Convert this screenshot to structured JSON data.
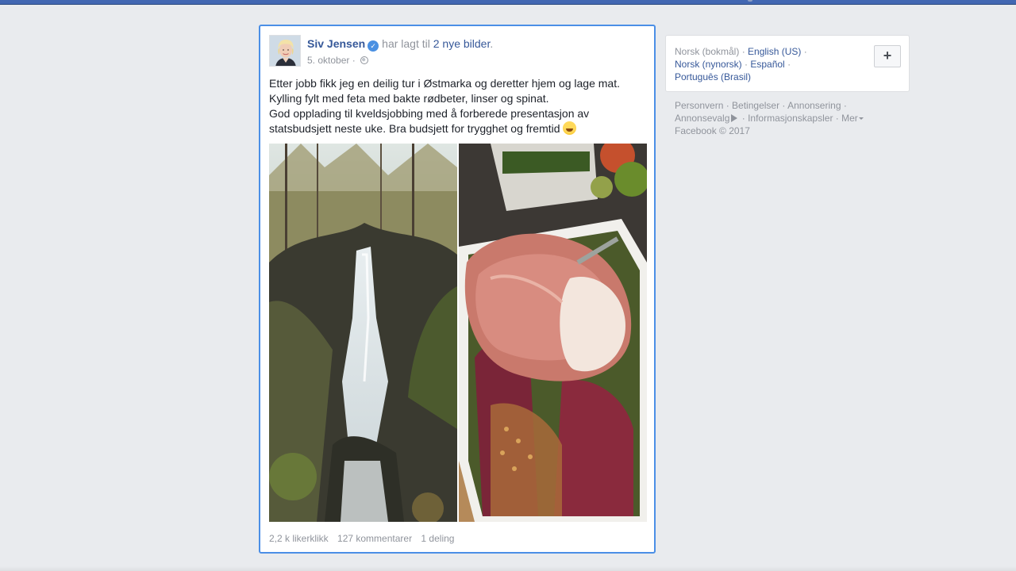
{
  "post": {
    "author": "Siv Jensen",
    "action_text": "har lagt til",
    "action_link": "2 nye bilder",
    "period": ".",
    "date": "5. oktober",
    "separator": "·",
    "paragraphs": [
      "Etter jobb fikk jeg en deilig tur i Østmarka og deretter hjem og lage mat.",
      "Kylling fylt med feta med bakte rødbeter, linser og spinat.",
      "God opplading til kveldsjobbing med å forberede presentasjon av statsbudsjett neste uke. Bra budsjett for trygghet og fremtid"
    ],
    "photos": [
      {
        "name": "waterfall-photo"
      },
      {
        "name": "food-photo"
      }
    ],
    "stats": {
      "likes": "2,2 k likerklikk",
      "comments": "127 kommentarer",
      "shares": "1 deling"
    },
    "icons": {
      "verified": "verified-badge-icon",
      "privacy": "globe-icon",
      "emoji": "laughing-emoji-icon"
    }
  },
  "sidebar": {
    "languages": {
      "current": "Norsk (bokmål)",
      "options": [
        "English (US)",
        "Norsk (nynorsk)",
        "Español",
        "Português (Brasil)"
      ],
      "add_button": "+"
    },
    "footer": {
      "links": [
        "Personvern",
        "Betingelser",
        "Annonsering",
        "Annonsevalg",
        "Informasjonskapsler",
        "Mer"
      ],
      "copyright": "Facebook © 2017"
    }
  },
  "colors": {
    "link": "#365899",
    "topbar": "#4267b2",
    "highlight_border": "#4b8fe6",
    "muted": "#90949c"
  }
}
